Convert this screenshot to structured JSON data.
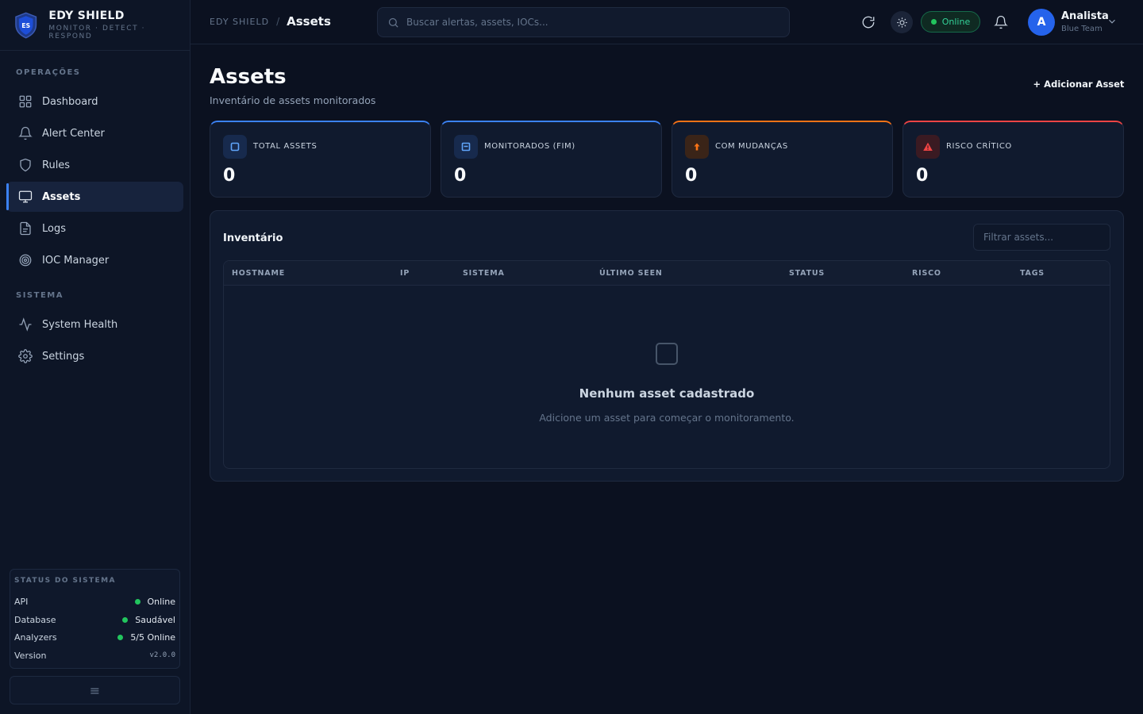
{
  "brand": {
    "name": "EDY SHIELD",
    "tagline": "MONITOR · DETECT · RESPOND",
    "logo_text": "ES"
  },
  "sidebar": {
    "sections": [
      {
        "title": "OPERAÇÕES",
        "items": [
          {
            "label": "Dashboard",
            "icon": "grid-icon"
          },
          {
            "label": "Alert Center",
            "icon": "bell-icon"
          },
          {
            "label": "Rules",
            "icon": "shield-icon"
          },
          {
            "label": "Assets",
            "icon": "monitor-icon",
            "active": true
          },
          {
            "label": "Logs",
            "icon": "file-icon"
          },
          {
            "label": "IOC Manager",
            "icon": "target-icon"
          }
        ]
      },
      {
        "title": "SISTEMA",
        "items": [
          {
            "label": "System Health",
            "icon": "activity-icon"
          },
          {
            "label": "Settings",
            "icon": "gear-icon"
          }
        ]
      }
    ],
    "status": {
      "title": "STATUS DO SISTEMA",
      "rows": [
        {
          "label": "API",
          "value": "Online"
        },
        {
          "label": "Database",
          "value": "Saudável"
        },
        {
          "label": "Analyzers",
          "value": "5/5 Online"
        },
        {
          "label": "Version",
          "value": "v2.0.0"
        }
      ]
    },
    "collapse_icon": "≡"
  },
  "topbar": {
    "breadcrumb_root": "EDY SHIELD",
    "breadcrumb_sep": "/",
    "breadcrumb_current": "Assets",
    "search_placeholder": "Buscar alertas, assets, IOCs...",
    "status": "Online",
    "user": {
      "initial": "A",
      "name": "Analista",
      "role": "Blue Team"
    }
  },
  "page": {
    "title": "Assets",
    "subtitle": "Inventário de assets monitorados",
    "add_button": "+ Adicionar Asset"
  },
  "stats": [
    {
      "label": "TOTAL ASSETS",
      "value": "0",
      "accent": "#3b82f6"
    },
    {
      "label": "MONITORADOS (FIM)",
      "value": "0",
      "accent": "#3b82f6"
    },
    {
      "label": "COM MUDANÇAS",
      "value": "0",
      "accent": "#f97316"
    },
    {
      "label": "RISCO CRÍTICO",
      "value": "0",
      "accent": "#ef4444"
    }
  ],
  "inventory": {
    "title": "Inventário",
    "filter_placeholder": "Filtrar assets...",
    "columns": [
      "HOSTNAME",
      "IP",
      "SISTEMA",
      "ÚLTIMO SEEN",
      "STATUS",
      "RISCO",
      "TAGS"
    ],
    "empty_title": "Nenhum asset cadastrado",
    "empty_subtitle": "Adicione um asset para começar o monitoramento."
  }
}
